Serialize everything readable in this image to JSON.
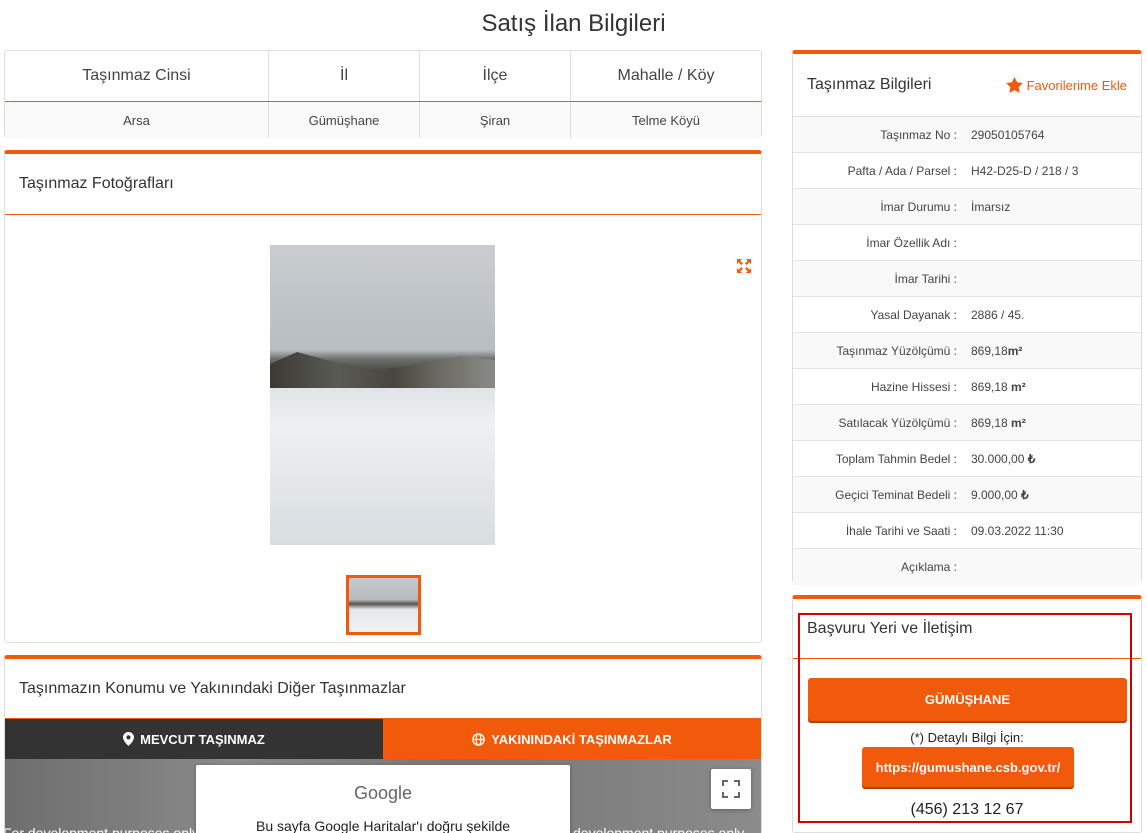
{
  "page": {
    "title": "Satış İlan Bilgileri"
  },
  "summary": {
    "headers": [
      "Taşınmaz Cinsi",
      "İl",
      "İlçe",
      "Mahalle / Köy"
    ],
    "values": [
      "Arsa",
      "Gümüşhane",
      "Şiran",
      "Telme Köyü"
    ]
  },
  "photos": {
    "title": "Taşınmaz Fotoğrafları"
  },
  "location": {
    "title": "Taşınmazın Konumu ve Yakınındaki Diğer Taşınmazlar",
    "tab_current": "MEVCUT TAŞINMAZ",
    "tab_nearby": "YAKININDAKİ TAŞINMAZLAR",
    "map_logo": "Google",
    "map_message": "Bu sayfa Google Haritalar'ı doğru şekilde",
    "dev_left": "For development purposes only",
    "dev_right": "development purposes only"
  },
  "info": {
    "title": "Taşınmaz Bilgileri",
    "favorite_label": "Favorilerime Ekle",
    "rows": [
      {
        "label": "Taşınmaz No :",
        "value": "29050105764"
      },
      {
        "label": "Pafta / Ada / Parsel :",
        "value": "H42-D25-D / 218 / 3"
      },
      {
        "label": "İmar Durumu :",
        "value": "İmarsız"
      },
      {
        "label": "İmar Özellik Adı :",
        "value": ""
      },
      {
        "label": "İmar Tarihi :",
        "value": ""
      },
      {
        "label": "Yasal Dayanak :",
        "value": "2886 / 45."
      },
      {
        "label": "Taşınmaz Yüzölçümü :",
        "value": "869,18",
        "unit": "m²"
      },
      {
        "label": "Hazine Hissesi :",
        "value": "869,18 ",
        "unit": "m²"
      },
      {
        "label": "Satılacak Yüzölçümü :",
        "value": "869,18 ",
        "unit": "m²"
      },
      {
        "label": "Toplam Tahmin Bedel :",
        "value": "30.000,00 ",
        "unit": "₺"
      },
      {
        "label": "Geçici Teminat Bedeli :",
        "value": "9.000,00 ",
        "unit": "₺"
      },
      {
        "label": "İhale Tarihi ve Saati :",
        "value": "09.03.2022 11:30"
      },
      {
        "label": "Açıklama :",
        "value": ""
      }
    ]
  },
  "contact": {
    "title": "Başvuru Yeri ve İletişim",
    "city_button": "GÜMÜŞHANE",
    "detail_text": "(*) Detaylı Bilgi İçin:",
    "link_button": "https://gumushane.csb.gov.tr/",
    "phone": "(456) 213 12 67"
  },
  "colors": {
    "accent": "#f15a0a",
    "dark_tab": "#333333",
    "highlight_box": "#d40000"
  }
}
